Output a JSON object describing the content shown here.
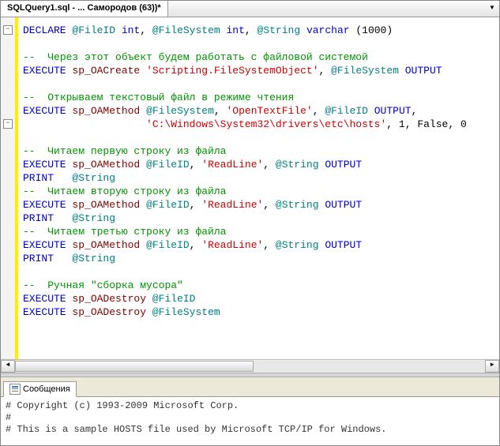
{
  "tab": {
    "title": "SQLQuery1.sql - ... Самородов (63))*"
  },
  "code": {
    "l1": {
      "kw": "DECLARE",
      "v1": "@FileID",
      "t1": "int",
      "c1": ", ",
      "v2": "@FileSystem",
      "t2": "int",
      "c2": ", ",
      "v3": "@String",
      "t3": "varchar",
      "p1": " (",
      "n1": "1000",
      "p2": ")"
    },
    "l3": {
      "pre": "--  ",
      "txt": "Через этот объект будем работать с файловой системой"
    },
    "l4": {
      "kw": "EXECUTE",
      "proc": "sp_OACreate",
      "s": "'Scripting.FileSystemObject'",
      "c": ", ",
      "v": "@FileSystem",
      "out": " OUTPUT"
    },
    "l6": {
      "pre": "--  ",
      "txt": "Открываем текстовый файл в режиме чтения"
    },
    "l7": {
      "kw": "EXECUTE",
      "proc": "sp_OAMethod",
      "v1": "@FileSystem",
      "c1": ", ",
      "s": "'OpenTextFile'",
      "c2": ", ",
      "v2": "@FileID",
      "out": " OUTPUT",
      "c3": ","
    },
    "l8": {
      "s": "'C:\\Windows\\System32\\drivers\\etc\\hosts'",
      "c1": ", ",
      "n1": "1",
      "c2": ", ",
      "n2": "False",
      "c3": ", ",
      "n3": "0"
    },
    "l10": {
      "pre": "--  ",
      "txt": "Читаем первую строку из файла"
    },
    "l11": {
      "kw": "EXECUTE",
      "proc": "sp_OAMethod",
      "v1": "@FileID",
      "c1": ", ",
      "s": "'ReadLine'",
      "c2": ", ",
      "v2": "@String",
      "out": " OUTPUT"
    },
    "l12": {
      "kw": "PRINT",
      "sp": "   ",
      "v": "@String"
    },
    "l13": {
      "pre": "--  ",
      "txt": "Читаем вторую строку из файла"
    },
    "l14": {
      "kw": "EXECUTE",
      "proc": "sp_OAMethod",
      "v1": "@FileID",
      "c1": ", ",
      "s": "'ReadLine'",
      "c2": ", ",
      "v2": "@String",
      "out": " OUTPUT"
    },
    "l15": {
      "kw": "PRINT",
      "sp": "   ",
      "v": "@String"
    },
    "l16": {
      "pre": "--  ",
      "txt": "Читаем третью строку из файла"
    },
    "l17": {
      "kw": "EXECUTE",
      "proc": "sp_OAMethod",
      "v1": "@FileID",
      "c1": ", ",
      "s": "'ReadLine'",
      "c2": ", ",
      "v2": "@String",
      "out": " OUTPUT"
    },
    "l18": {
      "kw": "PRINT",
      "sp": "   ",
      "v": "@String"
    },
    "l20": {
      "pre": "--  ",
      "txt": "Ручная \"сборка мусора\""
    },
    "l21": {
      "kw": "EXECUTE",
      "proc": "sp_OADestroy",
      "v": "@FileID"
    },
    "l22": {
      "kw": "EXECUTE",
      "proc": "sp_OADestroy",
      "v": "@FileSystem"
    }
  },
  "messages": {
    "tab_label": "Сообщения",
    "line1": "# Copyright (c) 1993-2009 Microsoft Corp.",
    "line2": "#",
    "line3": "# This is a sample HOSTS file used by Microsoft TCP/IP for Windows."
  }
}
